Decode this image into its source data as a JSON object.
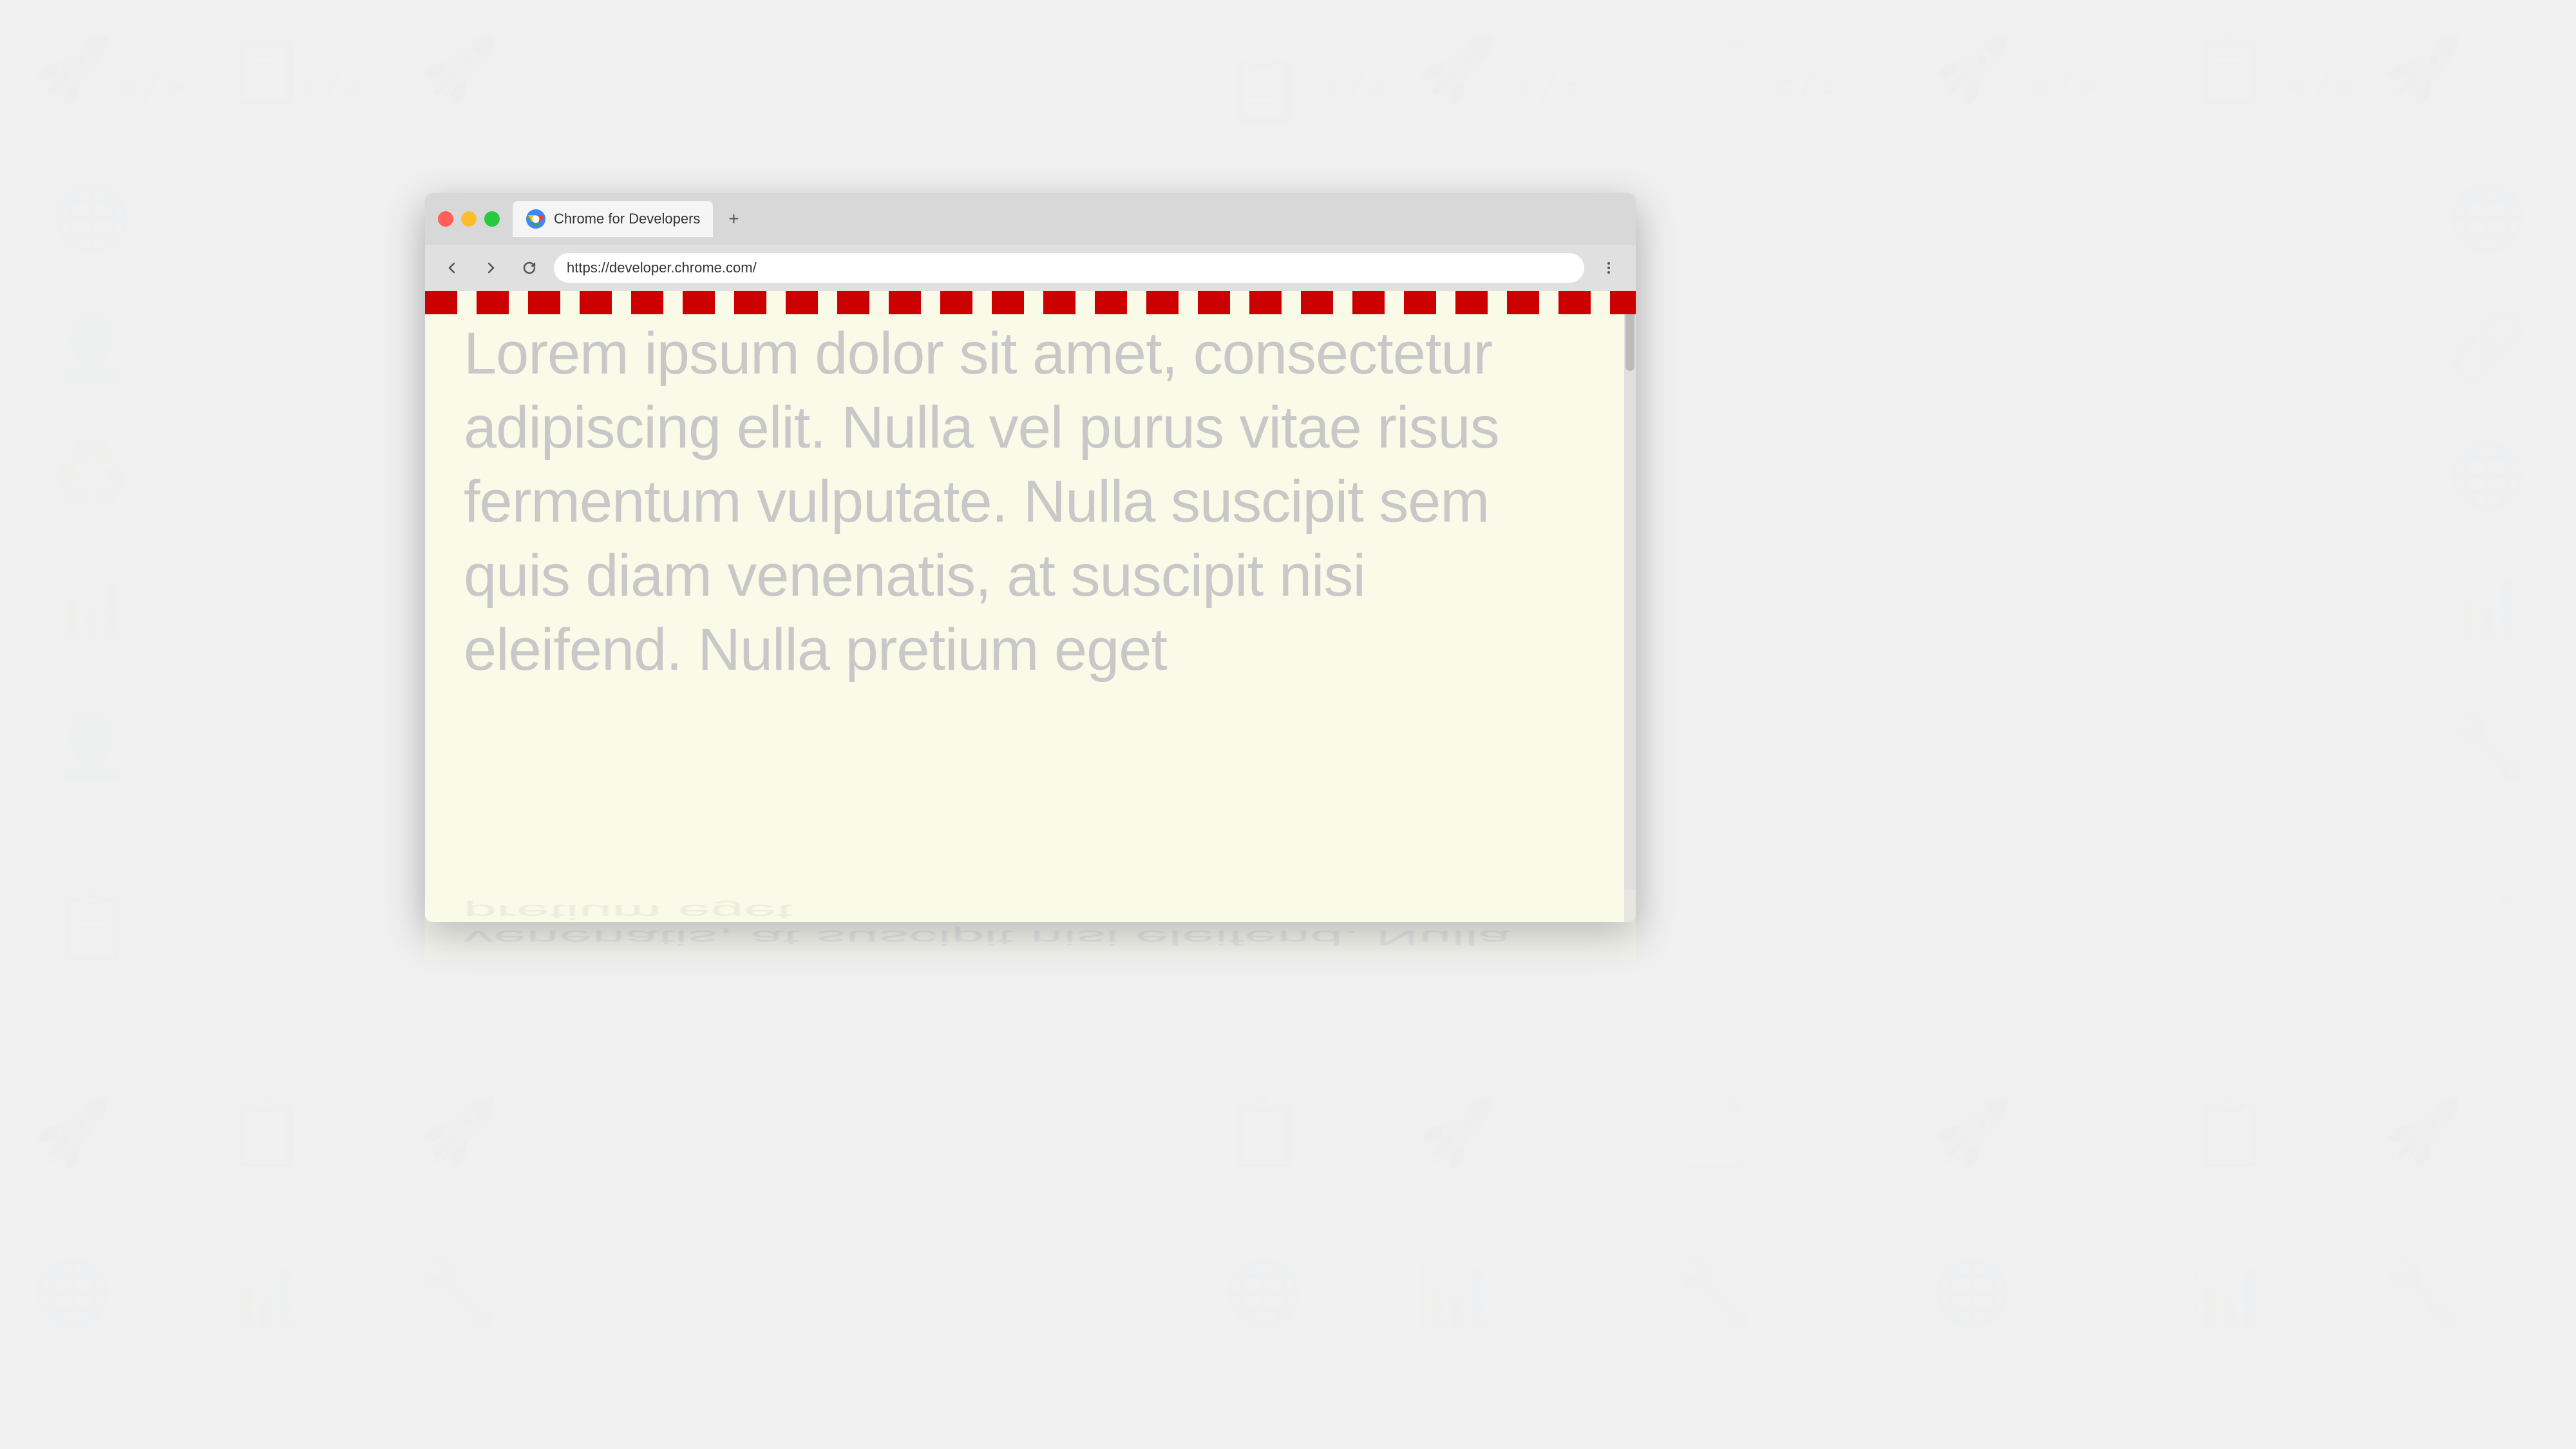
{
  "background": {
    "color": "#f0f0f0"
  },
  "browser": {
    "title": "Chrome for Developers",
    "url": "https://developer.chrome.com/",
    "tab": {
      "label": "Chrome for Developers",
      "favicon_alt": "chrome-favicon"
    },
    "new_tab_label": "+",
    "nav": {
      "back_title": "Back",
      "forward_title": "Forward",
      "reload_title": "Reload",
      "menu_title": "More options"
    }
  },
  "page": {
    "background_color": "#fafae8",
    "lorem_text": "Lorem ipsum dolor sit amet, consectetur adipiscing elit. Nulla vel purus vitae risus fermentum vulputate. Nulla suscipit sem quis diam venenatis, at suscipit nisi eleifend. Nulla pretium eget",
    "border_color": "#cc0000"
  },
  "reflection": {
    "text": "venenatis, at suscipit nisi eleifend. Nulla pretium eget"
  }
}
